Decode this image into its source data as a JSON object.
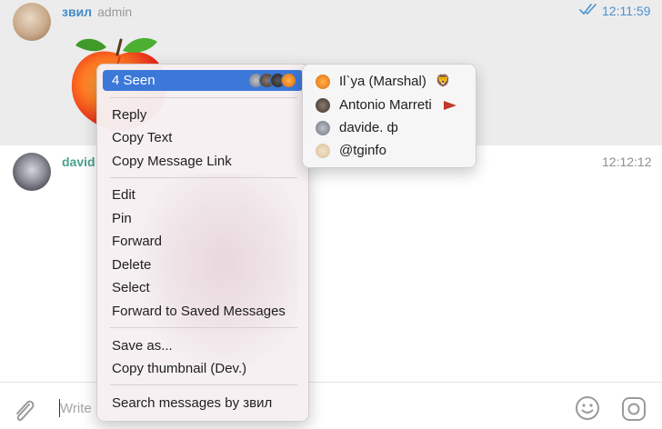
{
  "messages": [
    {
      "sender": "звил",
      "role": "admin",
      "time": "12:11:59",
      "sticker": "peach-sticker",
      "status": "double-check-icon"
    },
    {
      "sender": "david",
      "time": "12:12:12"
    }
  ],
  "context_menu": {
    "seen_label": "4 Seen",
    "groups": [
      [
        "Reply",
        "Copy Text",
        "Copy Message Link"
      ],
      [
        "Edit",
        "Pin",
        "Forward",
        "Delete",
        "Select",
        "Forward to Saved Messages"
      ],
      [
        "Save as...",
        "Copy thumbnail (Dev.)"
      ],
      [
        "Search messages by звил"
      ]
    ]
  },
  "seen_by": [
    {
      "name": "Il`ya (Marshal)",
      "badge": "🦁"
    },
    {
      "name": "Antonio Marreti",
      "badge": "flag-icon"
    },
    {
      "name": "davide. ф"
    },
    {
      "name": "@tginfo"
    }
  ],
  "composer": {
    "placeholder": "Write",
    "icons": [
      "paperclip-icon",
      "emoji-icon",
      "camera-icon"
    ]
  },
  "colors": {
    "accent": "#3b78d8",
    "sender_zvil": "#3f8bc9",
    "sender_david": "#4aa38a",
    "time": "#4b92cf"
  }
}
